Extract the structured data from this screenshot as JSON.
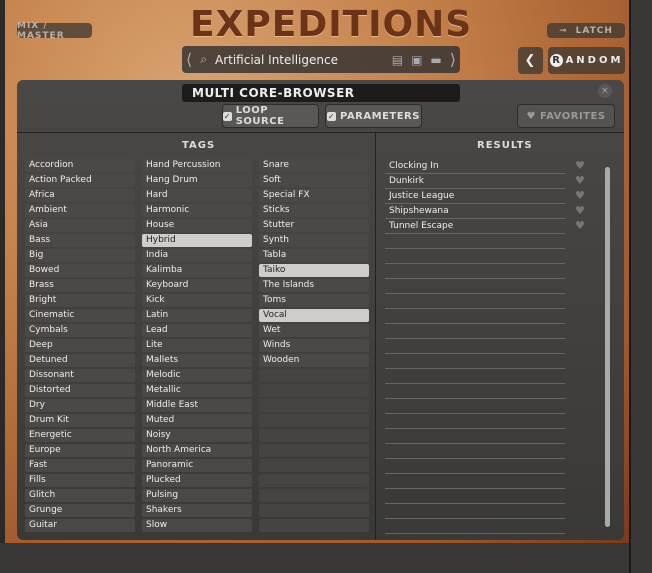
{
  "header": {
    "title": "EXPEDITIONS",
    "mix_master": "MIX / MASTER",
    "latch": "LATCH",
    "preset_name": "Artificial Intelligence",
    "random": "ANDOM",
    "random_badge": "R"
  },
  "browser": {
    "title": "MULTI CORE-BROWSER",
    "loop_source": "LOOP SOURCE",
    "parameters": "PARAMETERS",
    "favorites": "FAVORITES",
    "tags_header": "TAGS",
    "results_header": "RESULTS"
  },
  "tags": {
    "col1": [
      "Accordion",
      "Action Packed",
      "Africa",
      "Ambient",
      "Asia",
      "Bass",
      "Big",
      "Bowed",
      "Brass",
      "Bright",
      "Cinematic",
      "Cymbals",
      "Deep",
      "Detuned",
      "Dissonant",
      "Distorted",
      "Dry",
      "Drum Kit",
      "Energetic",
      "Europe",
      "Fast",
      "Fills",
      "Glitch",
      "Grunge",
      "Guitar"
    ],
    "col2": [
      "Hand Percussion",
      "Hang Drum",
      "Hard",
      "Harmonic",
      "House",
      "Hybrid",
      "India",
      "Kalimba",
      "Keyboard",
      "Kick",
      "Latin",
      "Lead",
      "Lite",
      "Mallets",
      "Melodic",
      "Metallic",
      "Middle East",
      "Muted",
      "Noisy",
      "North America",
      "Panoramic",
      "Plucked",
      "Pulsing",
      "Shakers",
      "Slow"
    ],
    "col3": [
      "Snare",
      "Soft",
      "Special FX",
      "Sticks",
      "Stutter",
      "Synth",
      "Tabla",
      "Taiko",
      "The Islands",
      "Toms",
      "Vocal",
      "Wet",
      "Winds",
      "Wooden"
    ],
    "selected": [
      "Hybrid",
      "Taiko",
      "Vocal"
    ]
  },
  "results": [
    "Clocking In",
    "Dunkirk",
    "Justice League",
    "Shipshewana",
    "Tunnel Escape"
  ]
}
